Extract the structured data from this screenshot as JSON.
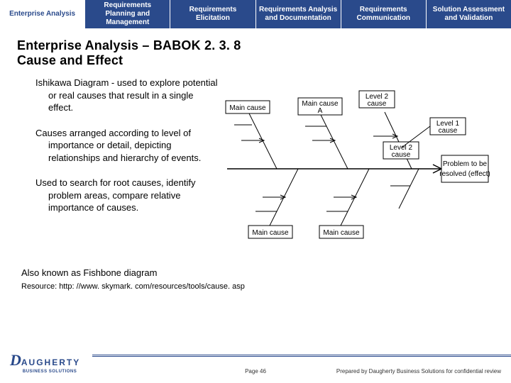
{
  "tabs": [
    {
      "label": "Enterprise Analysis",
      "active": true
    },
    {
      "label": "Requirements Planning and Management",
      "active": false
    },
    {
      "label": "Requirements Elicitation",
      "active": false
    },
    {
      "label": "Requirements Analysis and Documentation",
      "active": false
    },
    {
      "label": "Requirements Communication",
      "active": false
    },
    {
      "label": "Solution Assessment and Validation",
      "active": false
    }
  ],
  "title_line1": "Enterprise Analysis – BABOK 2. 3. 8",
  "title_line2": "Cause and Effect",
  "paragraphs": [
    "Ishikawa Diagram - used to explore potential or real causes that result in a single effect.",
    "Causes arranged according to level of importance or detail, depicting relationships and hierarchy of events.",
    "Used to search for root causes, identify problem areas, compare relative importance of causes."
  ],
  "also_known": "Also known as Fishbone diagram",
  "resource_label": "Resource: http: //www. skymark. com/resources/tools/cause. asp",
  "diagram": {
    "upper_cause_left": "Main cause",
    "upper_cause_mid": "Main cause A",
    "level2": "Level 2 cause",
    "level1": "Level 1 cause",
    "lower_cause_left": "Main cause",
    "lower_cause_right": "Main cause",
    "problem_line1": "Problem to be",
    "problem_line2": "resolved (effect)"
  },
  "footer": {
    "logo_rest": "AUGHERTY",
    "logo_sub": "BUSINESS SOLUTIONS",
    "page": "Page 46",
    "confidential": "Prepared by Daugherty Business Solutions for confidential review"
  }
}
